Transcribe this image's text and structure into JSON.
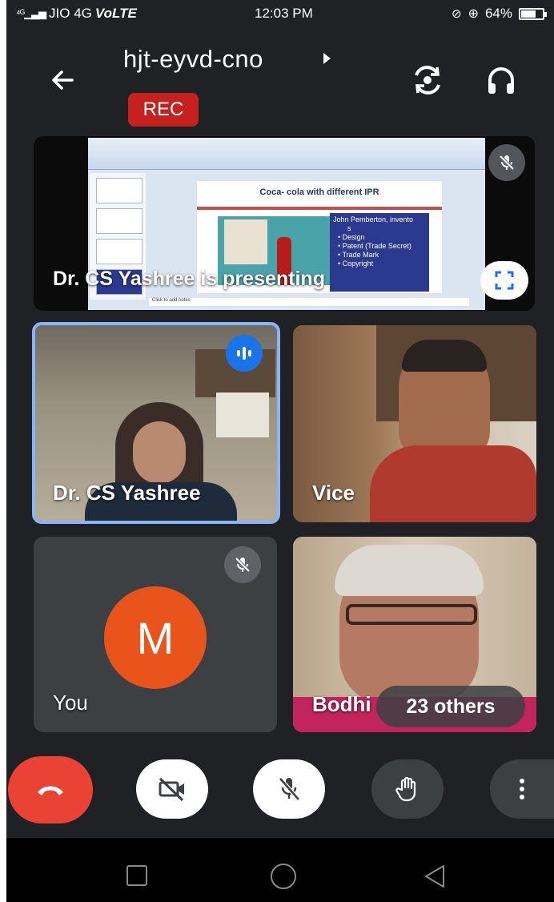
{
  "status_bar": {
    "carrier": "JIO 4G",
    "network": "VoLTE",
    "time": "12:03 PM",
    "battery": "64%"
  },
  "header": {
    "meeting_code": "hjt-eyvd-cno",
    "rec_label": "REC"
  },
  "presentation": {
    "caption": "Dr. CS Yashree is presenting",
    "mic_muted": true,
    "slide": {
      "title": "Coca- cola with different IPR",
      "heading": "John Pemberton, invento",
      "heading_cont": "s",
      "bullets": [
        "Design",
        "Patent (Trade Secret)",
        "Trade Mark",
        "Copyright"
      ],
      "notes": "Click to add notes"
    }
  },
  "participants": [
    {
      "name": "Dr. CS Yashree",
      "speaking": true
    },
    {
      "name": "Vice"
    },
    {
      "name": "You",
      "initial": "M",
      "mic_muted": true
    },
    {
      "name": "Bodhi",
      "others_label": "23 others"
    }
  ],
  "colors": {
    "background": "#202124",
    "tile": "#3c4043",
    "rec": "#c5221f",
    "end_call": "#ea4335",
    "avatar": "#e8541c",
    "speaking": "#8ab4f8"
  },
  "controls": [
    "end-call",
    "camera-off",
    "mic-off",
    "raise-hand",
    "more-options"
  ]
}
